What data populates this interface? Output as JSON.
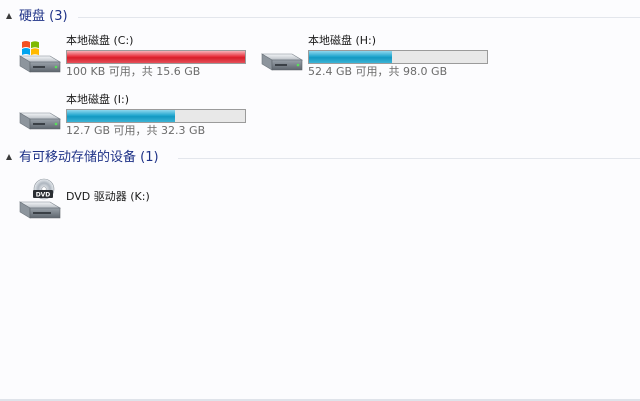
{
  "groups": {
    "hdd": {
      "title": "硬盘 (3)",
      "drives": [
        {
          "name": "本地磁盘 (C:)",
          "info": "100 KB 可用，共 15.6 GB",
          "used_percent": 100,
          "bar_color": "#d81e29",
          "icon": "windows-drive-icon"
        },
        {
          "name": "本地磁盘 (H:)",
          "info": "52.4 GB 可用，共 98.0 GB",
          "used_percent": 46.5,
          "bar_color": "#1398c2",
          "icon": "hard-drive-icon"
        },
        {
          "name": "本地磁盘 (I:)",
          "info": "12.7 GB 可用，共 32.3 GB",
          "used_percent": 60.7,
          "bar_color": "#1398c2",
          "icon": "hard-drive-icon"
        }
      ]
    },
    "removable": {
      "title": "有可移动存储的设备 (1)",
      "drives": [
        {
          "name": "DVD 驱动器 (K:)",
          "icon": "dvd-drive-icon"
        }
      ]
    }
  }
}
